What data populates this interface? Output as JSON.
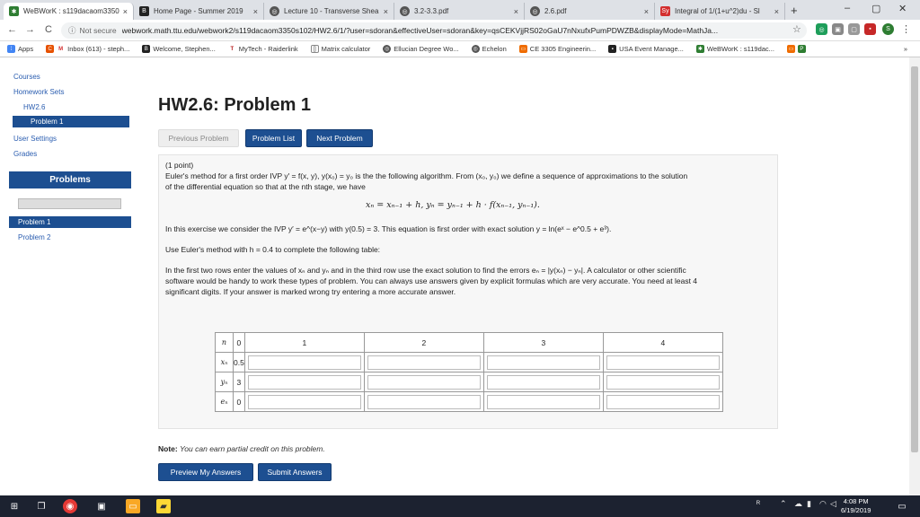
{
  "browser": {
    "tabs": [
      {
        "label": "WeBWorK : s119dacaom3350",
        "color": "#2e7d32"
      },
      {
        "label": "Home Page - Summer 2019",
        "color": "#333"
      },
      {
        "label": "Lecture 10 - Transverse Shea",
        "color": "#333"
      },
      {
        "label": "3.2-3.3.pdf",
        "color": "#333"
      },
      {
        "label": "2.6.pdf",
        "color": "#333"
      },
      {
        "label": "Integral of 1/(1+u^2)du - Sl",
        "color": "#d32f2f"
      }
    ],
    "tab_close": "×",
    "new_tab": "+",
    "window_controls": {
      "minimize": "–",
      "restore": "▢",
      "close": "✕"
    },
    "nav": {
      "back": "←",
      "forward": "→",
      "reload": "C"
    },
    "not_secure": "Not secure",
    "url": "webwork.math.ttu.edu/webwork2/s119dacaom3350s102/HW2.6/1/?user=sdoran&effectiveUser=sdoran&key=qsCEKVjjRS02oGaU7nNxufxPumPDWZB&displayMode=MathJa...",
    "star": "☆",
    "bookmarks": [
      "Apps",
      "Inbox (613) - steph...",
      "Welcome, Stephen...",
      "MyTech - Raiderlink",
      "Matrix calculator",
      "Ellucian Degree Wo...",
      "Echelon",
      "CE 3305 Engineerin...",
      "USA Event Manage...",
      "WeBWorK : s119dac..."
    ],
    "bookmarks_more": "»"
  },
  "sidebar": {
    "links": [
      "Courses",
      "Homework Sets",
      "HW2.6",
      "Problem 1",
      "User Settings",
      "Grades"
    ],
    "problems_header": "Problems",
    "problem_list": [
      "Problem 1",
      "Problem 2"
    ]
  },
  "main": {
    "title": "HW2.6: Problem 1",
    "buttons": {
      "previous": "Previous Problem",
      "list": "Problem List",
      "next": "Next Problem"
    },
    "points": "(1 point)",
    "p1_line1": "Euler's method for a first order IVP y′ = f(x, y), y(x₀) = y₀ is the the following algorithm. From (x₀, y₀) we define a sequence of approximations to the solution",
    "p1_line2": "of the differential equation so that at the nth stage, we have",
    "equation": "xₙ = xₙ₋₁ + h,   yₙ = yₙ₋₁ + h · f(xₙ₋₁, yₙ₋₁).",
    "p2": "In this exercise we consider the IVP y′ = e^(x−y) with y(0.5) = 3. This equation is first order with exact solution y = ln(eˣ − e^0.5 + e³).",
    "p3": "Use Euler's method with h = 0.4 to complete the following table:",
    "p4_line1": "In the first two rows enter the values of xₙ and yₙ and in the third row use the exact solution to find the errors eₙ = |y(xₙ) − yₙ|. A calculator or other scientific",
    "p4_line2": "software would be handy to work these types of problem. You can always use answers given by explicit formulas which are very accurate. You need at least 4",
    "p4_line3": "significant digits. If your answer is marked wrong try entering a more accurate answer.",
    "table": {
      "n_label": "n",
      "col0": "0",
      "cols": [
        "1",
        "2",
        "3",
        "4"
      ],
      "rows": [
        {
          "label": "xₙ",
          "first": "0.5"
        },
        {
          "label": "yₙ",
          "first": "3"
        },
        {
          "label": "eₙ",
          "first": "0"
        }
      ]
    },
    "note_label": "Note:",
    "note_text": "You can earn partial credit on this problem.",
    "preview_button": "Preview My Answers",
    "submit_button": "Submit Answers"
  },
  "taskbar": {
    "time": "4:08 PM",
    "date": "6/19/2019"
  },
  "colors": {
    "accent": "#1d4f91",
    "tabbar": "#dee1e6",
    "taskbar": "#1c2230"
  }
}
